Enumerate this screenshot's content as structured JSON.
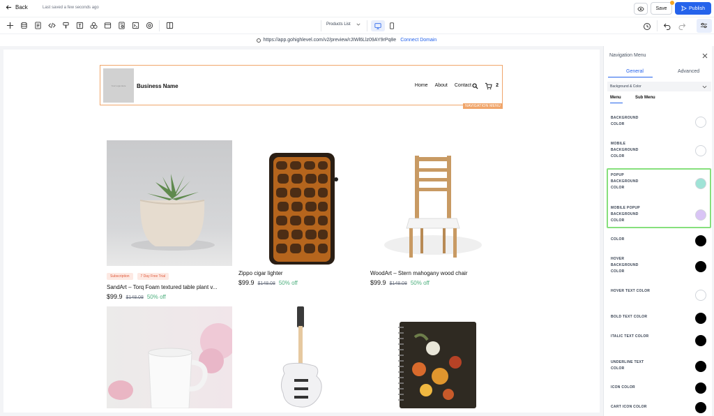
{
  "topbar": {
    "back_label": "Back",
    "saved_text": "Last saved a few seconds ago",
    "save_label": "Save",
    "publish_label": "Publish"
  },
  "toolbar": {
    "page_select": "Products List"
  },
  "urlbar": {
    "url": "https://app.gohighlevel.com/v2/preview/rJIWl6Llz09AY9rPq8e",
    "connect_label": "Connect Domain"
  },
  "site": {
    "logo_placeholder": "Your Logo Here",
    "business_name": "Business Name",
    "nav_links": [
      "Home",
      "About",
      "Contact"
    ],
    "cart_count": "2",
    "nav_tag": "NAVIGATION MENU"
  },
  "products": [
    {
      "name": "SandArt – Torq Foam textured table plant v...",
      "price": "$99.9",
      "old_price": "$148.08",
      "discount": "50% off",
      "badges": [
        "Subscription",
        "7 Day Free Trial"
      ]
    },
    {
      "name": "Zippo cigar lighter",
      "price": "$99.9",
      "old_price": "$148.08",
      "discount": "50% off"
    },
    {
      "name": "WoodArt – Stern mahogany wood chair",
      "price": "$99.9",
      "old_price": "$148.08",
      "discount": "50% off"
    }
  ],
  "panel": {
    "title": "Navigation Menu",
    "tabs": [
      "General",
      "Advanced"
    ],
    "section": "Background & Color",
    "subtabs": [
      "Menu",
      "Sub Menu"
    ],
    "properties": [
      {
        "label": "BACKGROUND COLOR",
        "color": "#ffffff"
      },
      {
        "label": "MOBILE BACKGROUND COLOR",
        "color": "#ffffff"
      },
      {
        "label": "POPUP BACKGROUND COLOR",
        "color": "#9fe3d6"
      },
      {
        "label": "MOBILE POPUP BACKGROUND COLOR",
        "color": "#d9c4f5"
      },
      {
        "label": "COLOR",
        "color": "#000000"
      },
      {
        "label": "HOVER BACKGROUND COLOR",
        "color": "#000000"
      },
      {
        "label": "HOVER TEXT COLOR",
        "color": "#ffffff"
      },
      {
        "label": "BOLD TEXT COLOR",
        "color": "#000000"
      },
      {
        "label": "ITALIC TEXT COLOR",
        "color": "#000000"
      },
      {
        "label": "UNDERLINE TEXT COLOR",
        "color": "#000000"
      },
      {
        "label": "ICON COLOR",
        "color": "#000000"
      },
      {
        "label": "CART ICON COLOR",
        "color": "#000000"
      }
    ]
  },
  "colors": {
    "accent": "#2563eb",
    "nav_outline": "#f0a56a",
    "highlight": "#86e07c",
    "discount": "#4caf7d"
  }
}
